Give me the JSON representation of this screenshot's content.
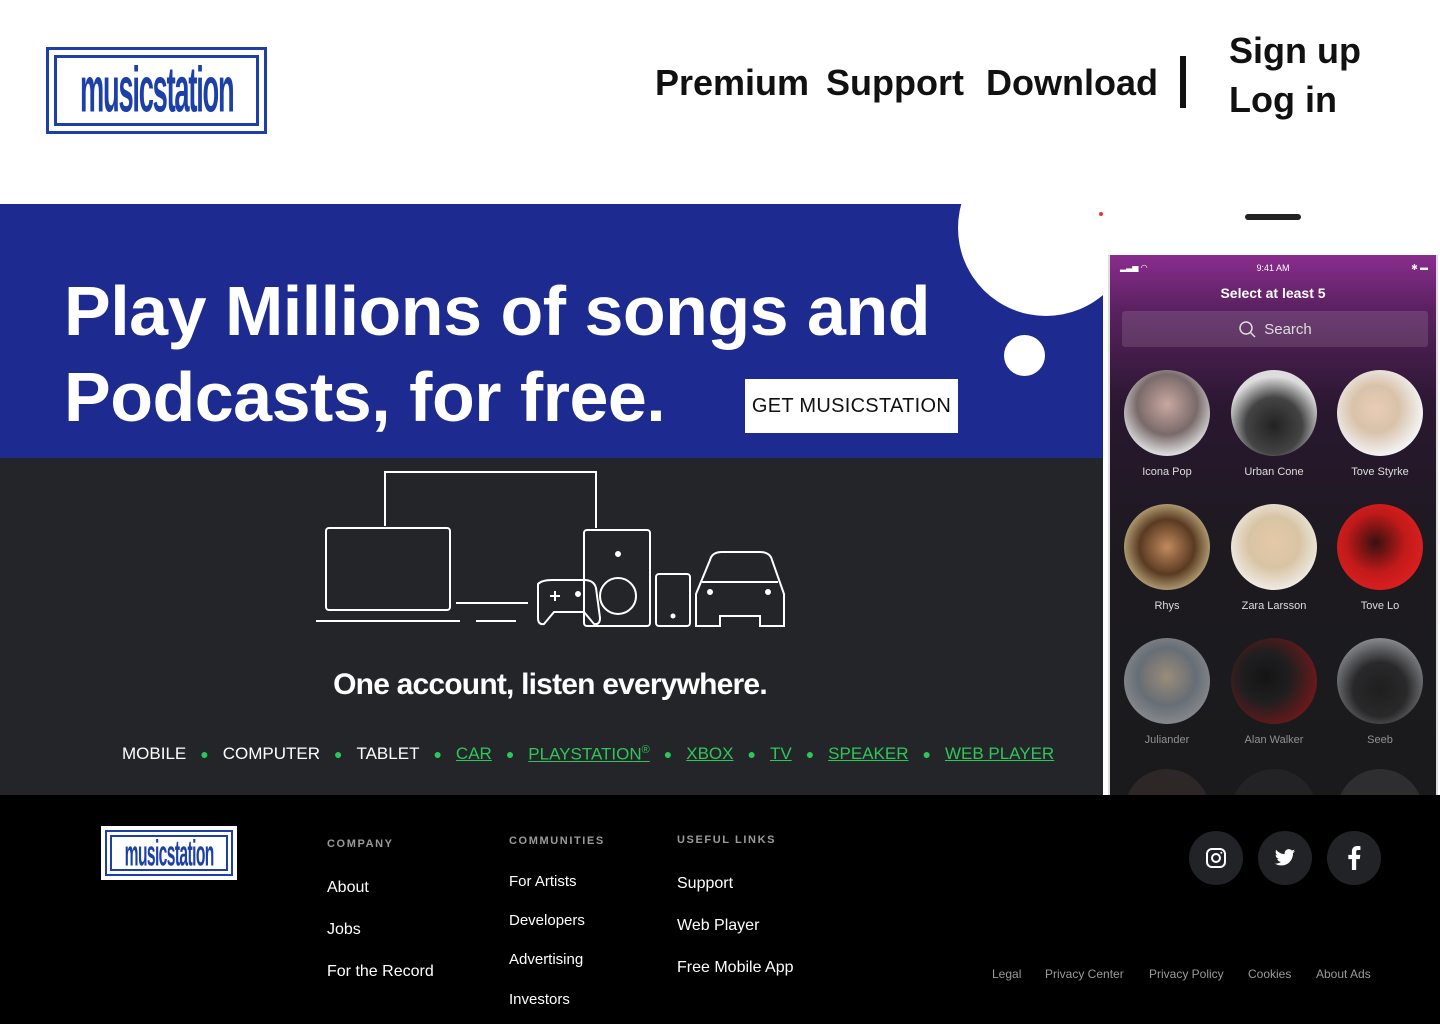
{
  "header": {
    "logo_text": "musicstation",
    "nav": {
      "premium": "Premium",
      "support": "Support",
      "download": "Download"
    },
    "signup": "Sign up",
    "login": "Log in"
  },
  "hero": {
    "title_line1": "Play Millions of songs and",
    "title_line2": "Podcasts, for free.",
    "cta": "GET MUSICSTATION",
    "bg_color": "#1d2a8f"
  },
  "devices": {
    "headline": "One account, listen everywhere.",
    "platforms": [
      {
        "label": "MOBILE",
        "link": false
      },
      {
        "label": "COMPUTER",
        "link": false
      },
      {
        "label": "TABLET",
        "link": false
      },
      {
        "label": "CAR",
        "link": true
      },
      {
        "label": "PLAYSTATION",
        "link": true
      },
      {
        "label": "XBOX",
        "link": true
      },
      {
        "label": "TV",
        "link": true
      },
      {
        "label": "SPEAKER",
        "link": true
      },
      {
        "label": "WEB PLAYER",
        "link": true
      }
    ],
    "accent_color": "#2ec65a"
  },
  "phone": {
    "time": "9:41 AM",
    "title": "Select at least 5",
    "search_placeholder": "Search",
    "artists": [
      "Icona Pop",
      "Urban Cone",
      "Tove Styrke",
      "Rhys",
      "Zara Larsson",
      "Tove Lo",
      "Juliander",
      "Alan Walker",
      "Seeb"
    ]
  },
  "footer": {
    "logo_text": "musicstation",
    "company": {
      "heading": "COMPANY",
      "links": [
        "About",
        "Jobs",
        "For the Record"
      ]
    },
    "communities": {
      "heading": "COMMUNITIES",
      "links": [
        "For Artists",
        "Developers",
        "Advertising",
        "Investors"
      ]
    },
    "useful": {
      "heading": "USEFUL LINKS",
      "links": [
        "Support",
        "Web Player",
        "Free Mobile App"
      ]
    },
    "social": [
      "instagram-icon",
      "twitter-icon",
      "facebook-icon"
    ],
    "legal": [
      "Legal",
      "Privacy Center",
      "Privacy Policy",
      "Cookies",
      "About Ads"
    ]
  }
}
